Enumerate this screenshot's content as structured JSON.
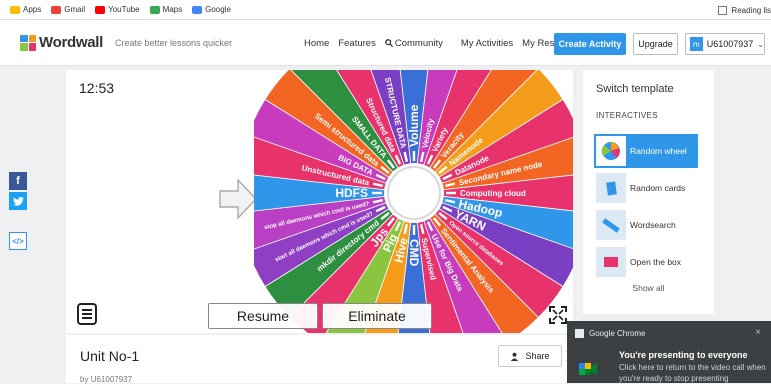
{
  "bookmarks": {
    "items": [
      {
        "label": "Apps",
        "icon": "apps-grid-icon",
        "color": "#fbbc04"
      },
      {
        "label": "Gmail",
        "icon": "gmail-icon",
        "color": "#ea4335"
      },
      {
        "label": "YouTube",
        "icon": "youtube-icon",
        "color": "#ff0000"
      },
      {
        "label": "Maps",
        "icon": "maps-icon",
        "color": "#34a853"
      },
      {
        "label": "Google",
        "icon": "google-icon",
        "color": "#4285f4"
      }
    ],
    "reading_list": "Reading lis"
  },
  "header": {
    "logo": "Wordwall",
    "tagline": "Create better lessons quicker",
    "nav": [
      "Home",
      "Features",
      "Community",
      "My Activities",
      "My Results"
    ],
    "create_label": "Create Activity",
    "upgrade_label": "Upgrade",
    "user_initial": "m",
    "username": "U61007937",
    "accent": "#2f96e9"
  },
  "activity": {
    "timer": "12:53",
    "resume_label": "Resume",
    "eliminate_label": "Eliminate",
    "wheel_segments": [
      {
        "label": "Volume",
        "color": "#3a6fd8"
      },
      {
        "label": "Velocity",
        "color": "#c93bbd"
      },
      {
        "label": "Variety",
        "color": "#e8326b"
      },
      {
        "label": "Veracity",
        "color": "#f26522"
      },
      {
        "label": "Namenode",
        "color": "#f59d1b"
      },
      {
        "label": "Datanode",
        "color": "#e8326b"
      },
      {
        "label": "Secondary name node",
        "color": "#f26522"
      },
      {
        "label": "Computing cloud",
        "color": "#e8326b"
      },
      {
        "label": "Hadoop",
        "color": "#2f96e9"
      },
      {
        "label": "YARN",
        "color": "#7b3fc4"
      },
      {
        "label": "Open source databases",
        "color": "#e8326b"
      },
      {
        "label": "Sentimental Analysis",
        "color": "#f26522"
      },
      {
        "label": "Use for Big Data",
        "color": "#c93bbd"
      },
      {
        "label": "Supervised",
        "color": "#e8326b"
      },
      {
        "label": "CMD",
        "color": "#3a6fd8"
      },
      {
        "label": "Hive",
        "color": "#f59d1b"
      },
      {
        "label": "Pig",
        "color": "#8bc53f"
      },
      {
        "label": "Jps",
        "color": "#e8326b"
      },
      {
        "label": "mkdir directory cmd",
        "color": "#2d8f3f"
      },
      {
        "label": "start all daemons which cmd is used?",
        "color": "#8e3fc4"
      },
      {
        "label": "stop all daemons which cmd is used?",
        "color": "#b93fc4"
      },
      {
        "label": "HDFS",
        "color": "#2f96e9"
      },
      {
        "label": "Unstructured data",
        "color": "#e8326b"
      },
      {
        "label": "BIG DATA",
        "color": "#c93bbd"
      },
      {
        "label": "Semi structured data",
        "color": "#f26522"
      },
      {
        "label": "SMALL DATA",
        "color": "#2d8f3f"
      },
      {
        "label": "Structured data",
        "color": "#e8326b"
      },
      {
        "label": "STRUCTURE DATA",
        "color": "#7b3fc4"
      }
    ]
  },
  "sidebar": {
    "title": "Switch template",
    "category": "INTERACTIVES",
    "templates": [
      {
        "label": "Random wheel",
        "selected": true
      },
      {
        "label": "Random cards",
        "selected": false
      },
      {
        "label": "Wordsearch",
        "selected": false
      },
      {
        "label": "Open the box",
        "selected": false
      }
    ],
    "show_all": "Show all"
  },
  "info": {
    "title": "Unit No-1",
    "by_prefix": "by",
    "author": "U61007937",
    "share_label": "Share"
  },
  "notification": {
    "app": "Google Chrome",
    "close": "×",
    "title": "You're presenting to everyone",
    "body": "Click here to return to the video call when you're ready to stop presenting"
  },
  "social": [
    {
      "icon": "facebook-icon",
      "glyph": "f",
      "color": "#3b5998"
    },
    {
      "icon": "twitter-icon",
      "glyph": "t",
      "color": "#1da1f2"
    },
    {
      "icon": "embed-icon",
      "glyph": "</>",
      "color": "#2f96e9"
    }
  ]
}
